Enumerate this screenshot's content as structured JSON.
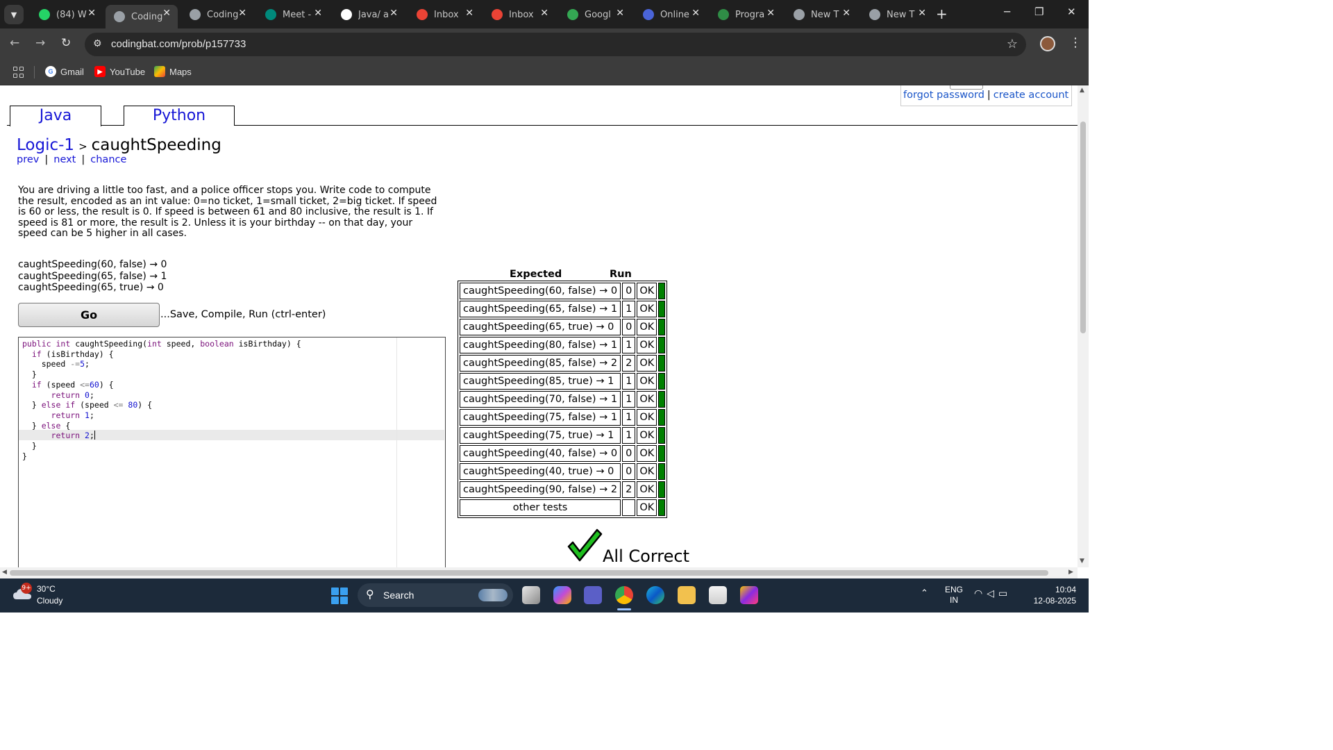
{
  "browser": {
    "tabs": [
      {
        "label": "(84) W",
        "icon": "whatsapp-icon",
        "color": "#25d366"
      },
      {
        "label": "Coding",
        "icon": "globe-icon",
        "color": "#9aa0a6",
        "active": true
      },
      {
        "label": "Coding",
        "icon": "globe-icon",
        "color": "#9aa0a6"
      },
      {
        "label": "Meet -",
        "icon": "meet-icon",
        "color": "#00897b"
      },
      {
        "label": "Java/ a",
        "icon": "github-icon",
        "color": "#ffffff"
      },
      {
        "label": "Inbox",
        "icon": "gmail-icon",
        "color": "#ea4335"
      },
      {
        "label": "Inbox",
        "icon": "gmail-icon",
        "color": "#ea4335"
      },
      {
        "label": "Googl",
        "icon": "google-meet-icon",
        "color": "#34a853"
      },
      {
        "label": "Online",
        "icon": "p-icon",
        "color": "#4a64d8"
      },
      {
        "label": "Progra",
        "icon": "gfg-icon",
        "color": "#2f8d46"
      },
      {
        "label": "New T",
        "icon": "chrome-icon",
        "color": "#9aa0a6"
      },
      {
        "label": "New T",
        "icon": "chrome-icon",
        "color": "#9aa0a6"
      }
    ],
    "url": "codingbat.com/prob/p157733",
    "bookmarks": [
      {
        "label": "Gmail",
        "icon": "google-icon"
      },
      {
        "label": "YouTube",
        "icon": "youtube-icon"
      },
      {
        "label": "Maps",
        "icon": "maps-icon"
      }
    ]
  },
  "page": {
    "login": {
      "forgot": "forgot password",
      "sep": "|",
      "create": "create account"
    },
    "lang_tabs": {
      "java": "Java",
      "python": "Python"
    },
    "breadcrumb": {
      "section": "Logic-1",
      "gt": ">",
      "problem": "caughtSpeeding"
    },
    "nav": {
      "prev": "prev",
      "next": "next",
      "chance": "chance",
      "sep": "|"
    },
    "description": "You are driving a little too fast, and a police officer stops you. Write code to compute the result, encoded as an int value: 0=no ticket, 1=small ticket, 2=big ticket. If speed is 60 or less, the result is 0. If speed is between 61 and 80 inclusive, the result is 1. If speed is 81 or more, the result is 2. Unless it is your birthday -- on that day, your speed can be 5 higher in all cases.",
    "examples": [
      "caughtSpeeding(60, false) → 0",
      "caughtSpeeding(65, false) → 1",
      "caughtSpeeding(65, true) → 0"
    ],
    "go_button": "Go",
    "go_hint": "...Save, Compile, Run (ctrl-enter)",
    "code_lines": [
      "public int caughtSpeeding(int speed, boolean isBirthday) {",
      "  if (isBirthday) {",
      "    speed -=5;",
      "  }",
      "  if (speed <=60) {",
      "      return 0;",
      "  } else if (speed <= 80) {",
      "      return 1;",
      "  } else {",
      "      return 2;",
      "  }",
      "}"
    ],
    "results": {
      "header_expected": "Expected",
      "header_run": "Run",
      "rows": [
        {
          "expected": "caughtSpeeding(60, false) → 0",
          "run": "0",
          "status": "OK"
        },
        {
          "expected": "caughtSpeeding(65, false) → 1",
          "run": "1",
          "status": "OK"
        },
        {
          "expected": "caughtSpeeding(65, true) → 0",
          "run": "0",
          "status": "OK"
        },
        {
          "expected": "caughtSpeeding(80, false) → 1",
          "run": "1",
          "status": "OK"
        },
        {
          "expected": "caughtSpeeding(85, false) → 2",
          "run": "2",
          "status": "OK"
        },
        {
          "expected": "caughtSpeeding(85, true) → 1",
          "run": "1",
          "status": "OK"
        },
        {
          "expected": "caughtSpeeding(70, false) → 1",
          "run": "1",
          "status": "OK"
        },
        {
          "expected": "caughtSpeeding(75, false) → 1",
          "run": "1",
          "status": "OK"
        },
        {
          "expected": "caughtSpeeding(75, true) → 1",
          "run": "1",
          "status": "OK"
        },
        {
          "expected": "caughtSpeeding(40, false) → 0",
          "run": "0",
          "status": "OK"
        },
        {
          "expected": "caughtSpeeding(40, true) → 0",
          "run": "0",
          "status": "OK"
        },
        {
          "expected": "caughtSpeeding(90, false) → 2",
          "run": "2",
          "status": "OK"
        },
        {
          "expected": "other tests",
          "run": "",
          "status": "OK"
        }
      ],
      "pass_color": "#008000",
      "summary": "All Correct"
    }
  },
  "taskbar": {
    "weather_badge": "9+",
    "temperature": "30°C",
    "condition": "Cloudy",
    "search_label": "Search",
    "lang_top": "ENG",
    "lang_bottom": "IN",
    "time": "10:04",
    "date": "12-08-2025"
  }
}
